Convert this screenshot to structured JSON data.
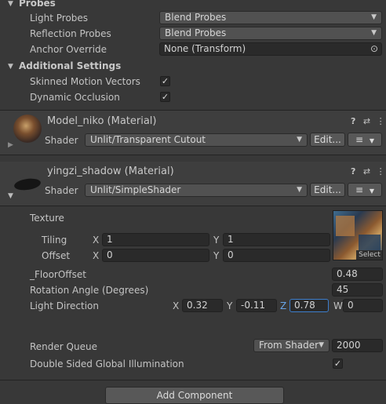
{
  "probes": {
    "header": "Probes",
    "light_probes_label": "Light Probes",
    "light_probes_value": "Blend Probes",
    "reflection_probes_label": "Reflection Probes",
    "reflection_probes_value": "Blend Probes",
    "anchor_override_label": "Anchor Override",
    "anchor_override_value": "None (Transform)"
  },
  "additional_settings": {
    "header": "Additional Settings",
    "skinned_motion_vectors_label": "Skinned Motion Vectors",
    "skinned_motion_vectors_checked": true,
    "dynamic_occlusion_label": "Dynamic Occlusion",
    "dynamic_occlusion_checked": true
  },
  "material1": {
    "name": "Model_niko (Material)",
    "shader_label": "Shader",
    "shader_value": "Unlit/Transparent Cutout",
    "edit_label": "Edit..."
  },
  "material2": {
    "name": "yingzi_shadow (Material)",
    "shader_label": "Shader",
    "shader_value": "Unlit/SimpleShader",
    "edit_label": "Edit...",
    "texture_label": "Texture",
    "select_label": "Select",
    "tiling_label": "Tiling",
    "offset_label": "Offset",
    "x_label": "X",
    "y_label": "Y",
    "z_label": "Z",
    "w_label": "W",
    "tiling_x": "1",
    "tiling_y": "1",
    "offset_x": "0",
    "offset_y": "0",
    "floor_offset_label": "_FloorOffset",
    "floor_offset_value": "0.48",
    "rotation_angle_label": "Rotation Angle (Degrees)",
    "rotation_angle_value": "45",
    "light_direction_label": "Light Direction",
    "light_dir_x": "0.32",
    "light_dir_y": "-0.11",
    "light_dir_z": "0.78",
    "light_dir_w": "0",
    "render_queue_label": "Render Queue",
    "render_queue_mode": "From Shader",
    "render_queue_value": "2000",
    "double_sided_gi_label": "Double Sided Global Illumination",
    "double_sided_gi_checked": true
  },
  "add_component_label": "Add Component",
  "glyphs": {
    "check": "✓",
    "dropdown_arrow": "▼",
    "expand_open": "▼",
    "expand_closed": "▶",
    "help": "?",
    "presets": "⇄",
    "more": "⋮",
    "list": "≡",
    "target": "⊙"
  }
}
